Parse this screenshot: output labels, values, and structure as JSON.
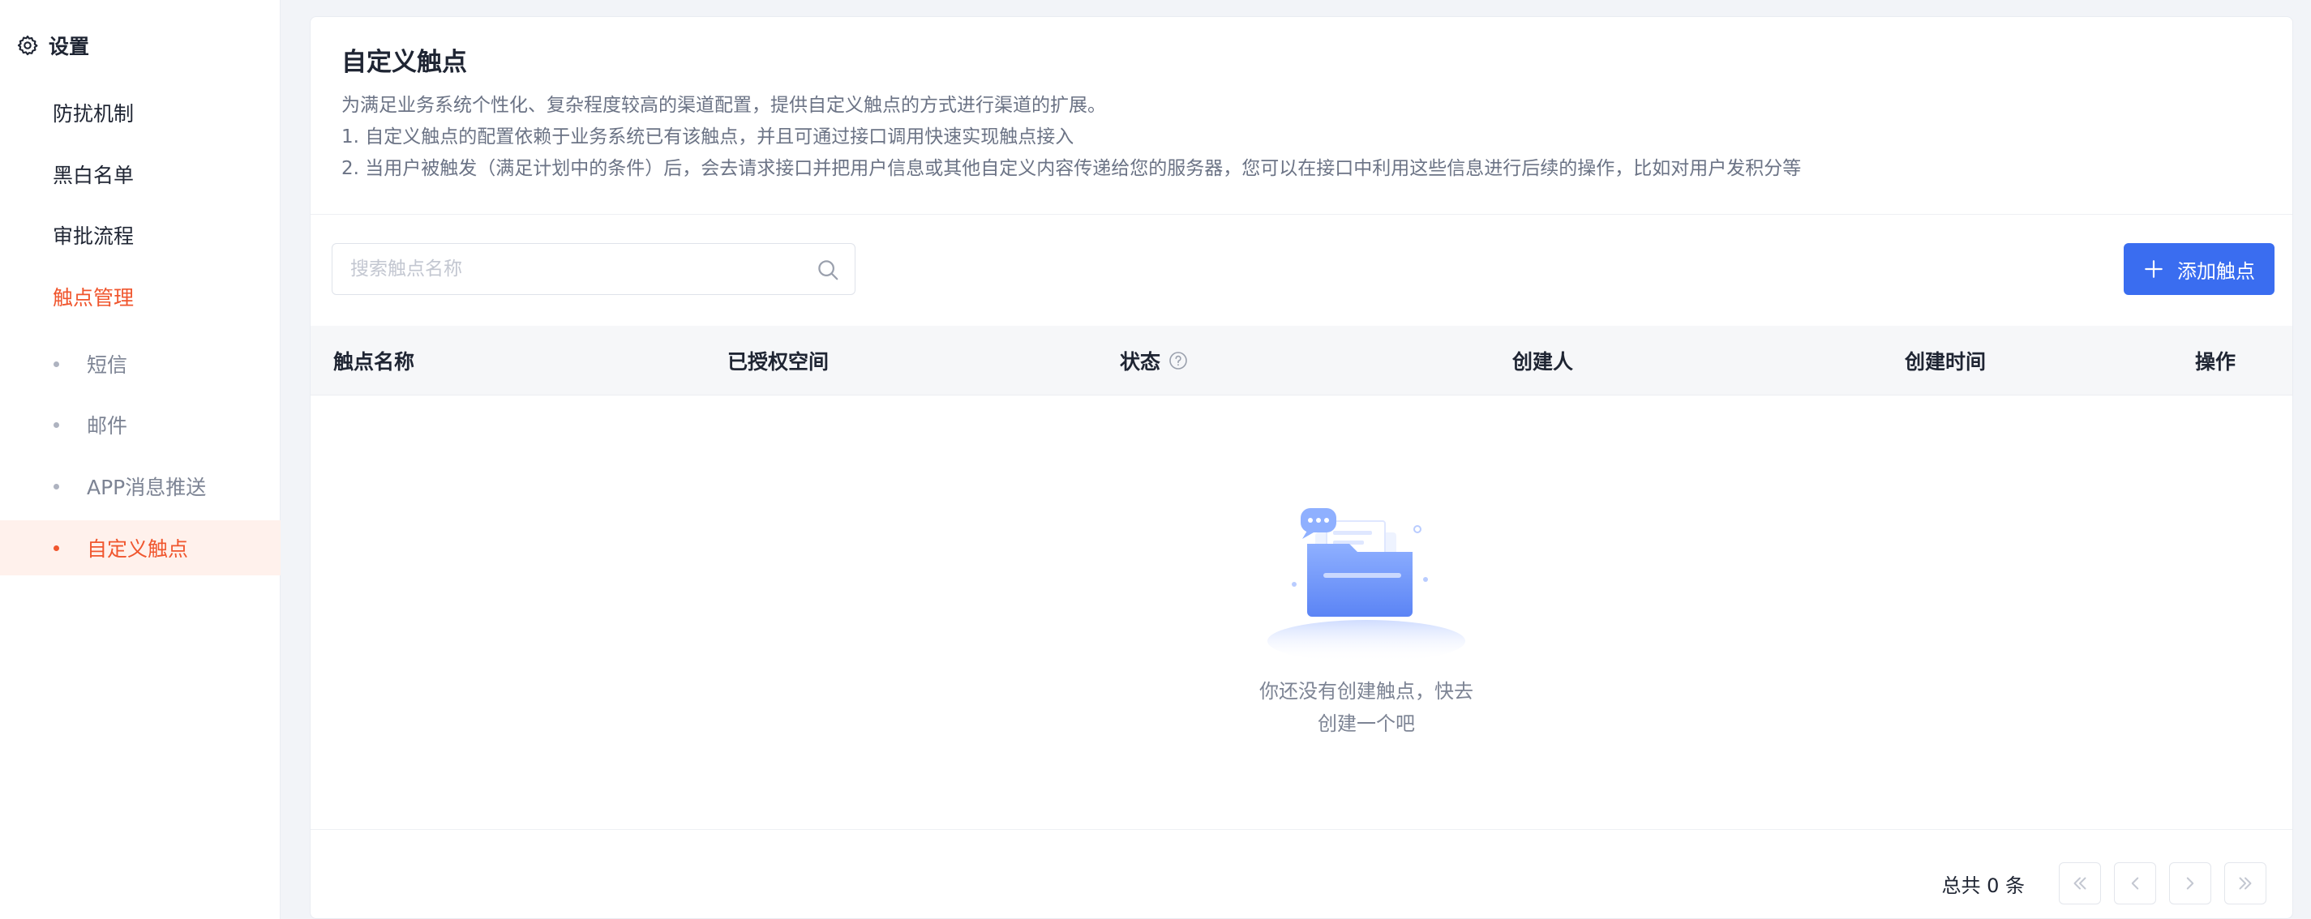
{
  "sidebar": {
    "title": "设置",
    "title_icon": "gear-icon",
    "items": [
      {
        "label": "防扰机制"
      },
      {
        "label": "黑白名单"
      },
      {
        "label": "审批流程"
      },
      {
        "label": "触点管理",
        "active": true
      }
    ],
    "sub_items": [
      {
        "label": "短信"
      },
      {
        "label": "邮件"
      },
      {
        "label": "APP消息推送"
      },
      {
        "label": "自定义触点",
        "active": true
      }
    ]
  },
  "main": {
    "title": "自定义触点",
    "description": [
      "为满足业务系统个性化、复杂程度较高的渠道配置，提供自定义触点的方式进行渠道的扩展。",
      "1. 自定义触点的配置依赖于业务系统已有该触点，并且可通过接口调用快速实现触点接入",
      "2. 当用户被触发（满足计划中的条件）后，会去请求接口并把用户信息或其他自定义内容传递给您的服务器，您可以在接口中利用这些信息进行后续的操作，比如对用户发积分等"
    ],
    "search": {
      "placeholder": "搜索触点名称",
      "value": "",
      "icon": "search-icon"
    },
    "add_button": {
      "label": "添加触点",
      "icon": "plus-icon"
    },
    "table": {
      "columns": [
        "触点名称",
        "已授权空间",
        "状态",
        "创建人",
        "创建时间",
        "操作"
      ],
      "status_help_icon": "question-circle-icon",
      "rows": []
    },
    "empty": {
      "text": "你还没有创建触点，快去创建一个吧",
      "icon": "empty-folder-illustration"
    },
    "pagination": {
      "total_label": "总共 0 条",
      "buttons": [
        "first-page-icon",
        "prev-page-icon",
        "next-page-icon",
        "last-page-icon"
      ]
    }
  },
  "colors": {
    "accent": "#f0562e",
    "accent_bg": "#fff1ec",
    "primary": "#3a6df0",
    "page_bg": "#f2f4f8"
  }
}
